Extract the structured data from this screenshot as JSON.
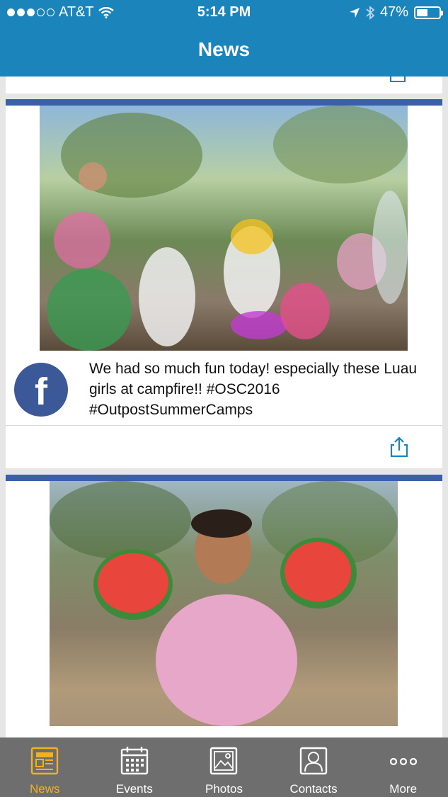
{
  "status_bar": {
    "carrier": "AT&T",
    "time": "5:14 PM",
    "battery": "47%",
    "battery_level": 0.47
  },
  "header": {
    "title": "News"
  },
  "posts": [
    {
      "source_icon": "facebook-icon",
      "text": "We had so much fun today! especially these Luau girls at campfire!! #OSC2016 #OutpostSummerCamps"
    }
  ],
  "tabs": [
    {
      "label": "News",
      "icon": "newspaper-icon",
      "active": true
    },
    {
      "label": "Events",
      "icon": "calendar-icon",
      "active": false
    },
    {
      "label": "Photos",
      "icon": "photo-icon",
      "active": false
    },
    {
      "label": "Contacts",
      "icon": "contacts-icon",
      "active": false
    },
    {
      "label": "More",
      "icon": "more-icon",
      "active": false
    }
  ],
  "colors": {
    "header": "#1a84bb",
    "card_accent": "#3b5fa8",
    "facebook": "#3b5998",
    "tabbar": "#6e6e6e",
    "active_tab": "#f3b21a"
  }
}
